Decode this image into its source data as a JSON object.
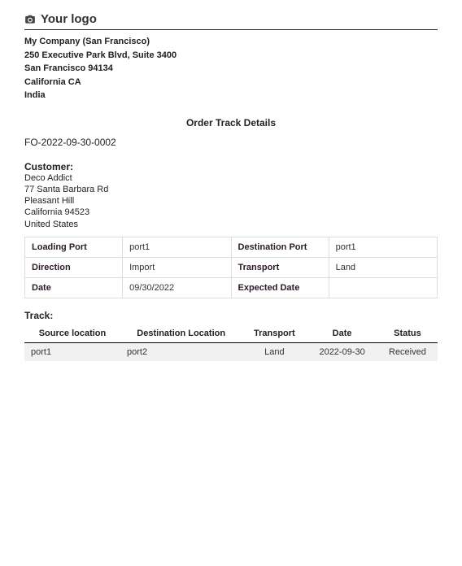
{
  "header": {
    "logo_text": "Your logo"
  },
  "company": {
    "name": "My Company (San Francisco)",
    "street": "250 Executive Park Blvd, Suite 3400",
    "city_zip": "San Francisco 94134",
    "state": "California CA",
    "country": "India"
  },
  "doc": {
    "title": "Order Track Details",
    "order_number": "FO-2022-09-30-0002"
  },
  "customer": {
    "heading": "Customer:",
    "name": "Deco Addict",
    "street": "77 Santa Barbara Rd",
    "city": "Pleasant Hill",
    "state_zip": "California 94523",
    "country": "United States"
  },
  "details": {
    "labels": {
      "loading_port": "Loading Port",
      "destination_port": "Destination Port",
      "direction": "Direction",
      "transport": "Transport",
      "date": "Date",
      "expected_date": "Expected Date"
    },
    "values": {
      "loading_port": "port1",
      "destination_port": "port1",
      "direction": "Import",
      "transport": "Land",
      "date": "09/30/2022",
      "expected_date": ""
    }
  },
  "track": {
    "heading": "Track:",
    "headers": {
      "source": "Source location",
      "destination": "Destination Location",
      "transport": "Transport",
      "date": "Date",
      "status": "Status"
    },
    "rows": [
      {
        "source": "port1",
        "destination": "port2",
        "transport": "Land",
        "date": "2022-09-30",
        "status": "Received"
      }
    ]
  }
}
